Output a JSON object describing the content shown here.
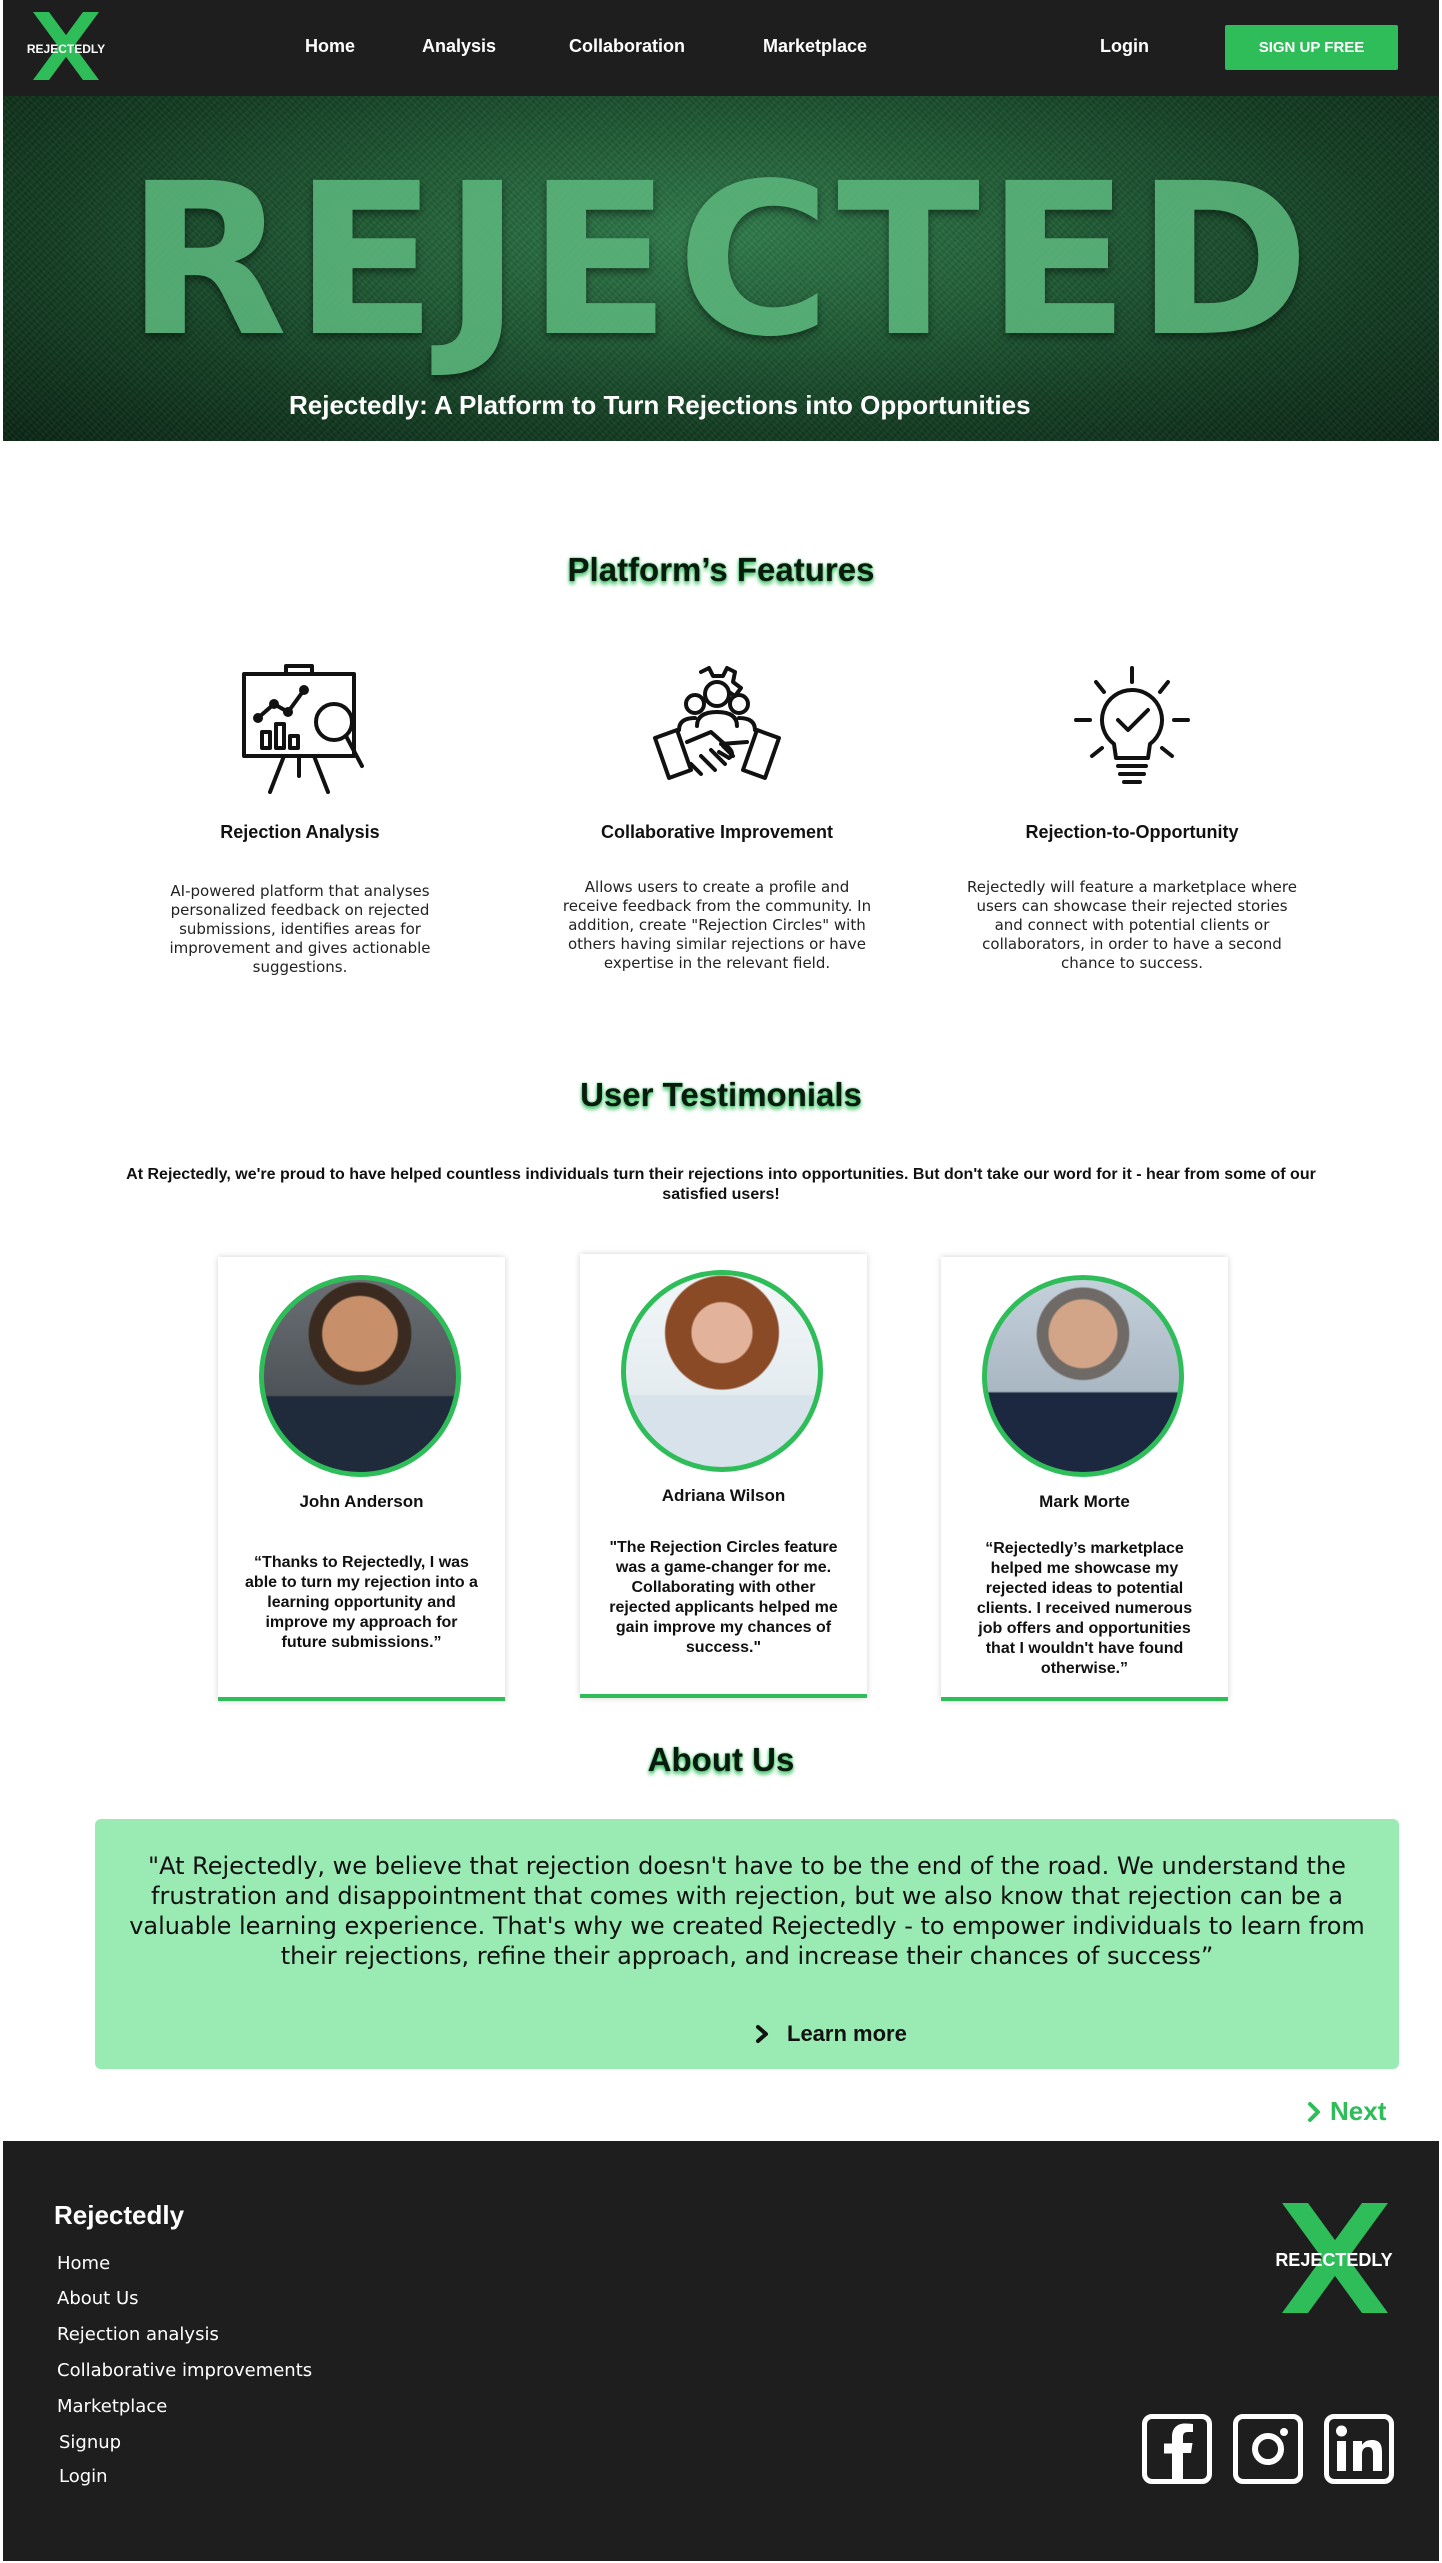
{
  "nav": {
    "logo_text": "REJECTEDLY",
    "links": [
      "Home",
      "Analysis",
      "Collaboration",
      "Marketplace"
    ],
    "login": "Login",
    "signup": "SIGN UP FREE"
  },
  "hero": {
    "word": "REJECTED",
    "caption": "Rejectedly: A Platform to Turn Rejections into Opportunities"
  },
  "features": {
    "title": "Platform’s Features",
    "items": [
      {
        "icon": "analysis-board-icon",
        "title": "Rejection Analysis",
        "desc": "AI-powered platform that analyses personalized feedback on rejected submissions, identifies areas for improvement and gives actionable suggestions."
      },
      {
        "icon": "handshake-team-icon",
        "title": "Collaborative Improvement",
        "desc": "Allows users to create a profile and receive feedback from the community. In addition, create \"Rejection Circles\" with others having similar rejections or have expertise in the relevant field."
      },
      {
        "icon": "lightbulb-check-icon",
        "title": "Rejection-to-Opportunity",
        "desc": "Rejectedly will feature a marketplace where users can showcase their rejected stories and connect with potential clients or collaborators, in order to have a second chance to success."
      }
    ]
  },
  "testimonials": {
    "title": "User Testimonials",
    "intro": "At Rejectedly, we're proud to have helped countless individuals turn their rejections into opportunities. But don't take our word for it - hear from some of our satisfied users!",
    "cards": [
      {
        "name": "John Anderson",
        "quote": "“Thanks to Rejectedly, I was able to turn my rejection into a learning opportunity and improve my approach for future submissions.”"
      },
      {
        "name": "Adriana Wilson",
        "quote": "\"The Rejection Circles feature was a game-changer for me. Collaborating with other rejected applicants helped me gain improve my chances of success.\""
      },
      {
        "name": "Mark Morte",
        "quote": "“Rejectedly’s marketplace helped me showcase my rejected ideas to potential clients. I received numerous job offers and opportunities that I wouldn't have found otherwise.”"
      }
    ]
  },
  "about": {
    "title": "About Us",
    "quote": "\"At Rejectedly, we believe that rejection doesn't have to be the end of the road. We understand the frustration and disappointment that comes with rejection, but we also know that rejection can be a valuable learning experience. That's why we created Rejectedly -  to empower individuals to learn from their rejections, refine their approach, and increase their chances of success”",
    "learn_more": "Learn more",
    "next": "Next"
  },
  "footer": {
    "brand": "Rejectedly",
    "links": [
      "Home",
      "About Us",
      "Rejection analysis",
      "Collaborative improvements",
      "Marketplace",
      "Signup",
      "Login"
    ],
    "logo_text": "REJECTEDLY",
    "social": [
      "facebook-icon",
      "instagram-icon",
      "linkedin-icon"
    ]
  },
  "colors": {
    "accent": "#2ebd59",
    "dark": "#1e1e1e",
    "about_bg": "#99ebb3"
  }
}
